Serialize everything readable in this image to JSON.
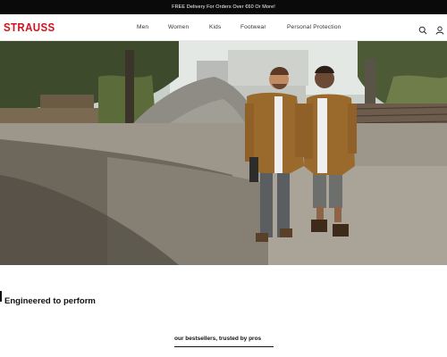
{
  "announcement": {
    "text": "FREE Delivery For Orders Over €60 Or More!"
  },
  "brand": {
    "logo_text": "STRAUSS",
    "color": "#d3121c"
  },
  "nav": {
    "items": [
      {
        "label": "Men"
      },
      {
        "label": "Women"
      },
      {
        "label": "Kids"
      },
      {
        "label": "Footwear"
      },
      {
        "label": "Personal Protection"
      }
    ],
    "icons": [
      "search-icon",
      "account-icon"
    ]
  },
  "hero": {
    "image": "two workers in brown work shirts and grey trousers/shorts standing in a gravel yard"
  },
  "section": {
    "heading": "Engineered to perform"
  },
  "bestsellers": {
    "tab_label": "our bestsellers, trusted by pros"
  }
}
